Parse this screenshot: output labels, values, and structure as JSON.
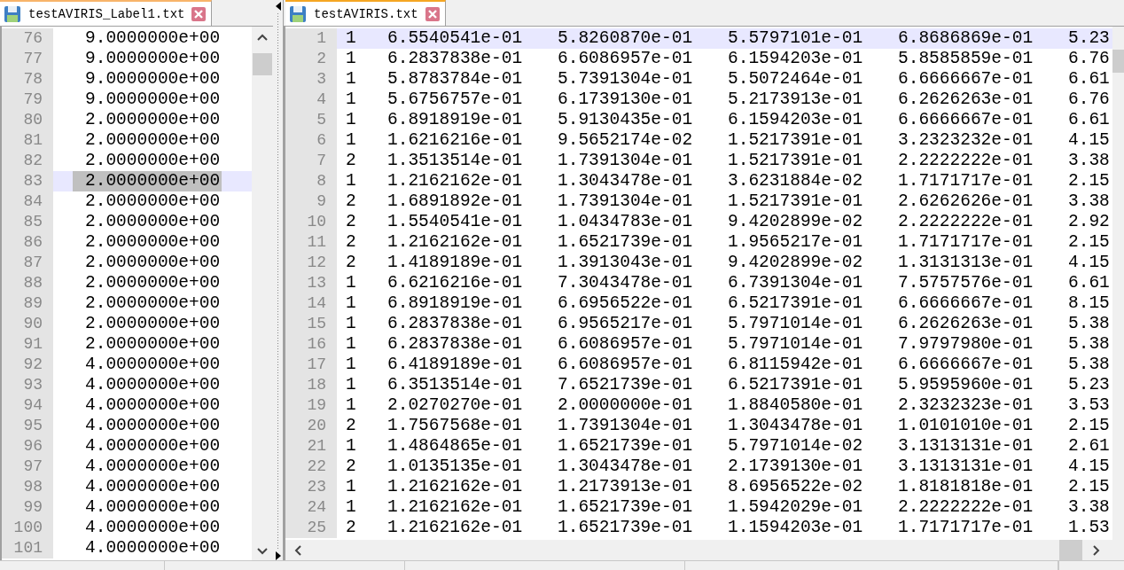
{
  "left_pane": {
    "tab": {
      "label": "testAVIRIS_Label1.txt"
    },
    "lines": [
      {
        "line": "76",
        "text": "9.0000000e+00",
        "current": false,
        "selected": false
      },
      {
        "line": "77",
        "text": "9.0000000e+00",
        "current": false,
        "selected": false
      },
      {
        "line": "78",
        "text": "9.0000000e+00",
        "current": false,
        "selected": false
      },
      {
        "line": "79",
        "text": "9.0000000e+00",
        "current": false,
        "selected": false
      },
      {
        "line": "80",
        "text": "2.0000000e+00",
        "current": false,
        "selected": false
      },
      {
        "line": "81",
        "text": "2.0000000e+00",
        "current": false,
        "selected": false
      },
      {
        "line": "82",
        "text": "2.0000000e+00",
        "current": false,
        "selected": false
      },
      {
        "line": "83",
        "text": "2.0000000e+00",
        "current": true,
        "selected": true
      },
      {
        "line": "84",
        "text": "2.0000000e+00",
        "current": false,
        "selected": false
      },
      {
        "line": "85",
        "text": "2.0000000e+00",
        "current": false,
        "selected": false
      },
      {
        "line": "86",
        "text": "2.0000000e+00",
        "current": false,
        "selected": false
      },
      {
        "line": "87",
        "text": "2.0000000e+00",
        "current": false,
        "selected": false
      },
      {
        "line": "88",
        "text": "2.0000000e+00",
        "current": false,
        "selected": false
      },
      {
        "line": "89",
        "text": "2.0000000e+00",
        "current": false,
        "selected": false
      },
      {
        "line": "90",
        "text": "2.0000000e+00",
        "current": false,
        "selected": false
      },
      {
        "line": "91",
        "text": "2.0000000e+00",
        "current": false,
        "selected": false
      },
      {
        "line": "92",
        "text": "4.0000000e+00",
        "current": false,
        "selected": false
      },
      {
        "line": "93",
        "text": "4.0000000e+00",
        "current": false,
        "selected": false
      },
      {
        "line": "94",
        "text": "4.0000000e+00",
        "current": false,
        "selected": false
      },
      {
        "line": "95",
        "text": "4.0000000e+00",
        "current": false,
        "selected": false
      },
      {
        "line": "96",
        "text": "4.0000000e+00",
        "current": false,
        "selected": false
      },
      {
        "line": "97",
        "text": "4.0000000e+00",
        "current": false,
        "selected": false
      },
      {
        "line": "98",
        "text": "4.0000000e+00",
        "current": false,
        "selected": false
      },
      {
        "line": "99",
        "text": "4.0000000e+00",
        "current": false,
        "selected": false
      },
      {
        "line": "100",
        "text": "4.0000000e+00",
        "current": false,
        "selected": false
      },
      {
        "line": "101",
        "text": "4.0000000e+00",
        "current": false,
        "selected": false
      }
    ]
  },
  "right_pane": {
    "tab": {
      "label": "testAVIRIS.txt"
    },
    "lines": [
      {
        "line": "1",
        "current": true,
        "cells": [
          "1",
          "6.5540541e-01",
          "5.8260870e-01",
          "5.5797101e-01",
          "6.8686869e-01",
          "5.23"
        ]
      },
      {
        "line": "2",
        "current": false,
        "cells": [
          "1",
          "6.2837838e-01",
          "6.6086957e-01",
          "6.1594203e-01",
          "5.8585859e-01",
          "6.76"
        ]
      },
      {
        "line": "3",
        "current": false,
        "cells": [
          "1",
          "5.8783784e-01",
          "5.7391304e-01",
          "5.5072464e-01",
          "6.6666667e-01",
          "6.61"
        ]
      },
      {
        "line": "4",
        "current": false,
        "cells": [
          "1",
          "5.6756757e-01",
          "6.1739130e-01",
          "5.2173913e-01",
          "6.2626263e-01",
          "6.76"
        ]
      },
      {
        "line": "5",
        "current": false,
        "cells": [
          "1",
          "6.8918919e-01",
          "5.9130435e-01",
          "6.1594203e-01",
          "6.6666667e-01",
          "6.61"
        ]
      },
      {
        "line": "6",
        "current": false,
        "cells": [
          "1",
          "1.6216216e-01",
          "9.5652174e-02",
          "1.5217391e-01",
          "3.2323232e-01",
          "4.15"
        ]
      },
      {
        "line": "7",
        "current": false,
        "cells": [
          "2",
          "1.3513514e-01",
          "1.7391304e-01",
          "1.5217391e-01",
          "2.2222222e-01",
          "3.38"
        ]
      },
      {
        "line": "8",
        "current": false,
        "cells": [
          "1",
          "1.2162162e-01",
          "1.3043478e-01",
          "3.6231884e-02",
          "1.7171717e-01",
          "2.15"
        ]
      },
      {
        "line": "9",
        "current": false,
        "cells": [
          "2",
          "1.6891892e-01",
          "1.7391304e-01",
          "1.5217391e-01",
          "2.6262626e-01",
          "3.38"
        ]
      },
      {
        "line": "10",
        "current": false,
        "cells": [
          "2",
          "1.5540541e-01",
          "1.0434783e-01",
          "9.4202899e-02",
          "2.2222222e-01",
          "2.92"
        ]
      },
      {
        "line": "11",
        "current": false,
        "cells": [
          "2",
          "1.2162162e-01",
          "1.6521739e-01",
          "1.9565217e-01",
          "1.7171717e-01",
          "2.15"
        ]
      },
      {
        "line": "12",
        "current": false,
        "cells": [
          "2",
          "1.4189189e-01",
          "1.3913043e-01",
          "9.4202899e-02",
          "1.3131313e-01",
          "4.15"
        ]
      },
      {
        "line": "13",
        "current": false,
        "cells": [
          "1",
          "6.6216216e-01",
          "7.3043478e-01",
          "6.7391304e-01",
          "7.5757576e-01",
          "6.61"
        ]
      },
      {
        "line": "14",
        "current": false,
        "cells": [
          "1",
          "6.8918919e-01",
          "6.6956522e-01",
          "6.5217391e-01",
          "6.6666667e-01",
          "8.15"
        ]
      },
      {
        "line": "15",
        "current": false,
        "cells": [
          "1",
          "6.2837838e-01",
          "6.9565217e-01",
          "5.7971014e-01",
          "6.2626263e-01",
          "5.38"
        ]
      },
      {
        "line": "16",
        "current": false,
        "cells": [
          "1",
          "6.2837838e-01",
          "6.6086957e-01",
          "5.7971014e-01",
          "7.9797980e-01",
          "5.38"
        ]
      },
      {
        "line": "17",
        "current": false,
        "cells": [
          "1",
          "6.4189189e-01",
          "6.6086957e-01",
          "6.8115942e-01",
          "6.6666667e-01",
          "5.38"
        ]
      },
      {
        "line": "18",
        "current": false,
        "cells": [
          "1",
          "6.3513514e-01",
          "7.6521739e-01",
          "6.5217391e-01",
          "5.9595960e-01",
          "5.23"
        ]
      },
      {
        "line": "19",
        "current": false,
        "cells": [
          "1",
          "2.0270270e-01",
          "2.0000000e-01",
          "1.8840580e-01",
          "2.3232323e-01",
          "3.53"
        ]
      },
      {
        "line": "20",
        "current": false,
        "cells": [
          "2",
          "1.7567568e-01",
          "1.7391304e-01",
          "1.3043478e-01",
          "1.0101010e-01",
          "2.15"
        ]
      },
      {
        "line": "21",
        "current": false,
        "cells": [
          "1",
          "1.4864865e-01",
          "1.6521739e-01",
          "5.7971014e-02",
          "3.1313131e-01",
          "2.61"
        ]
      },
      {
        "line": "22",
        "current": false,
        "cells": [
          "2",
          "1.0135135e-01",
          "1.3043478e-01",
          "2.1739130e-01",
          "3.1313131e-01",
          "4.15"
        ]
      },
      {
        "line": "23",
        "current": false,
        "cells": [
          "1",
          "1.2162162e-01",
          "1.2173913e-01",
          "8.6956522e-02",
          "1.8181818e-01",
          "2.15"
        ]
      },
      {
        "line": "24",
        "current": false,
        "cells": [
          "1",
          "1.2162162e-01",
          "1.6521739e-01",
          "1.5942029e-01",
          "2.2222222e-01",
          "3.38"
        ]
      },
      {
        "line": "25",
        "current": false,
        "cells": [
          "2",
          "1.2162162e-01",
          "1.6521739e-01",
          "1.1594203e-01",
          "1.7171717e-01",
          "1.53"
        ]
      }
    ]
  }
}
